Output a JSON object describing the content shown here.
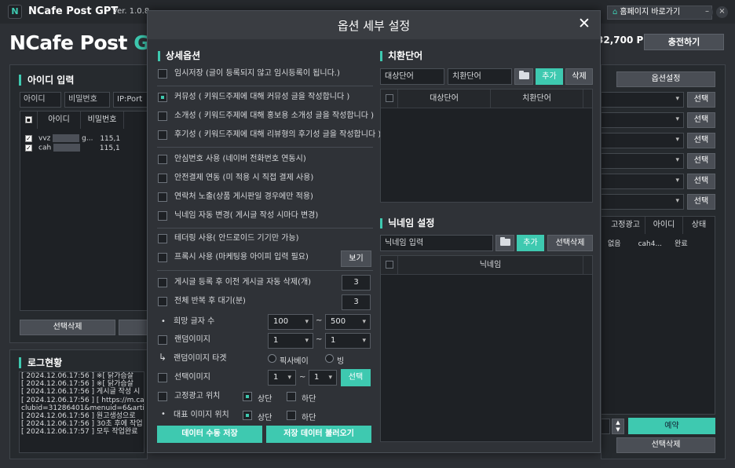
{
  "app": {
    "logo_letter": "N",
    "name": "NCafe Post GPT",
    "version": "Ver. 1.0.8",
    "brand_prefix": "NCafe Post ",
    "brand_suffix": "GPT",
    "points": "32,700 P",
    "charge_label": "충전하기",
    "home_label": "홈페이지 바로가기",
    "home_icon": "home-icon",
    "min_label": "–",
    "close_label": "×"
  },
  "id_panel": {
    "title": "아이디 입력",
    "id_placeholder": "아이디",
    "pw_placeholder": "비밀번호",
    "ip_placeholder": "IP:Port",
    "headers": [
      "아이디",
      "비밀번호"
    ],
    "rows": [
      {
        "id": "vvz",
        "extra": "g...",
        "ip": "115,1"
      },
      {
        "id": "cah",
        "extra": "",
        "ip": "115,1"
      }
    ],
    "delete_label": "선택삭제"
  },
  "log_panel": {
    "title": "로그현황",
    "lines": [
      "[ 2024.12.06.17:56 ] ※[ 닭가슴살",
      "[ 2024.12.06.17:56 ] ※[ 닭가슴살",
      "[ 2024.12.06.17:56 ] 게시글 작성 시",
      "[ 2024.12.06.17:56 ] [ https://m.ca",
      "clubid=31286401&menuid=6&article",
      "[ 2024.12.06.17:56 ] 원고생성으로",
      "[ 2024.12.06.17:56 ] 30초 후에 작업",
      "[ 2024.12.06.17:57 ] 모두 작업완료"
    ]
  },
  "right_panel": {
    "option_settings_label": "옵션설정",
    "select_label": "선택",
    "table_headers": [
      "고정광고",
      "아이디",
      "상태"
    ],
    "table_row": [
      "없음",
      "cah4...",
      "완료"
    ],
    "reserve_label": "예약",
    "delete_label": "선택삭제"
  },
  "modal": {
    "title": "옵션 세부 설정",
    "close_label": "✕",
    "detail": {
      "title": "상세옵션",
      "options": [
        {
          "label": "임시저장 (글이 등록되지 않고 임시등록이 됩니다.)",
          "checked": false
        },
        {
          "label": "커뮤성 ( 키워드주제에 대해 커뮤성 글을 작성합니다 )",
          "checked": true
        },
        {
          "label": "소개성 ( 키워드주제에 대해 홍보용 소개성 글을 작성합니다 )",
          "checked": false
        },
        {
          "label": "후기성 ( 키워드주제에 대해 리뷰형의 후기성 글을 작성합니다 )",
          "checked": false
        },
        {
          "label": "안심번호 사용 (네이버 전화번호 연동시)",
          "checked": false
        },
        {
          "label": "안전결제 연동 (미 적용 시 직접 결제 사용)",
          "checked": false
        },
        {
          "label": "연락처 노출(상품 게시판일 경우에만 적용)",
          "checked": false
        },
        {
          "label": "닉네임 자동 변경( 게시글 작성 시마다 변경)",
          "checked": false
        },
        {
          "label": "테더링 사용( 안드로이드 기기만 가능)",
          "checked": false
        },
        {
          "label": "프록시 사용 (마케팅용 아이피 입력 필요)",
          "checked": false
        },
        {
          "label": "게시글 등록 후 이전 게시글 자동 삭제(개)",
          "checked": false
        },
        {
          "label": "전체 반복 후 대기(분)",
          "checked": false
        }
      ],
      "view_label": "보기",
      "auto_delete_count": "3",
      "repeat_wait": "3",
      "char_count_label": "희망 글자 수",
      "char_min": "100",
      "char_max": "500",
      "random_image_label": "랜덤이미지",
      "random_min": "1",
      "random_max": "1",
      "random_target_label": "랜덤이미지 타겟",
      "target_pixabay": "픽사베이",
      "target_bing": "빙",
      "select_image_label": "선택이미지",
      "select_min": "1",
      "select_max": "1",
      "select_btn": "선택",
      "fixed_ad_label": "고정광고 위치",
      "rep_image_label": "대표 이미지 위치",
      "top_label": "상단",
      "bottom_label": "하단",
      "tilde": "~",
      "save_label": "데이터 수동 저장",
      "load_label": "저장 데이터 불러오기"
    },
    "replace": {
      "title": "치환단어",
      "target_placeholder": "대상단어",
      "replace_placeholder": "치환단어",
      "add_label": "추가",
      "delete_label": "삭제",
      "headers": [
        "대상단어",
        "치환단어"
      ]
    },
    "nickname": {
      "title": "닉네임 설정",
      "placeholder": "닉네임 입력",
      "add_label": "추가",
      "delete_label": "선택삭제",
      "header": "닉네임"
    }
  },
  "colors": {
    "accent": "#3ec9b0",
    "background": "#2d3035",
    "modal": "#2f3237"
  }
}
